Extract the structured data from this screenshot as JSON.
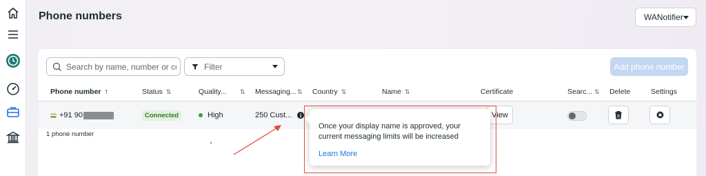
{
  "page": {
    "title": "Phone numbers"
  },
  "account": {
    "selected": "WANotifier"
  },
  "toolbar": {
    "search_placeholder": "Search by name, number or co...",
    "filter_label": "Filter",
    "add_button": "Add phone number"
  },
  "table": {
    "columns": {
      "phone": "Phone number",
      "status": "Status",
      "quality": "Quality...",
      "messaging": "Messaging...",
      "country": "Country",
      "name": "Name",
      "certificate": "Certificate",
      "search": "Searc...",
      "delete": "Delete",
      "settings": "Settings"
    },
    "sort_asc_glyph": "↑",
    "sort_glyph": "⇅",
    "rows": [
      {
        "phone": "+91 90",
        "status": "Connected",
        "quality": "High",
        "messaging": "250 Cust...",
        "certificate_button": "View"
      }
    ],
    "row_count": "1 phone number"
  },
  "tooltip": {
    "message": "Once your display name is approved, your current messaging limits will be increased",
    "link": "Learn More"
  },
  "colors": {
    "accent": "#1b74e4",
    "annotation": "#e04a3a",
    "status_good": "#31a24c"
  }
}
